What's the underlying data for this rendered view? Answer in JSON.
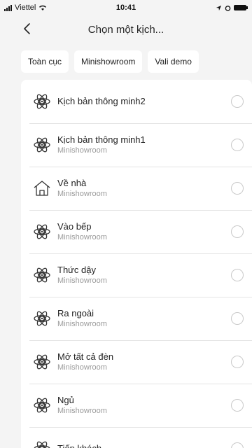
{
  "status_bar": {
    "carrier": "Viettel",
    "time": "10:41"
  },
  "header": {
    "title": "Chọn một kịch..."
  },
  "tabs": [
    {
      "label": "Toàn cục"
    },
    {
      "label": "Minishowroom"
    },
    {
      "label": "Vali demo"
    }
  ],
  "scenes": [
    {
      "title": "Kịch bản thông minh2",
      "subtitle": "",
      "icon": "atom-icon"
    },
    {
      "title": "Kịch bản thông minh1",
      "subtitle": "Minishowroom",
      "icon": "atom-icon"
    },
    {
      "title": "Về nhà",
      "subtitle": "Minishowroom",
      "icon": "home-icon"
    },
    {
      "title": "Vào bếp",
      "subtitle": "Minishowroom",
      "icon": "atom-icon"
    },
    {
      "title": "Thức dậy",
      "subtitle": "Minishowroom",
      "icon": "atom-icon"
    },
    {
      "title": "Ra ngoài",
      "subtitle": "Minishowroom",
      "icon": "atom-icon"
    },
    {
      "title": "Mở tất cả đèn",
      "subtitle": "Minishowroom",
      "icon": "atom-icon"
    },
    {
      "title": "Ngủ",
      "subtitle": "Minishowroom",
      "icon": "atom-icon"
    },
    {
      "title": "Tiếp khách",
      "subtitle": "",
      "icon": "atom-icon"
    }
  ]
}
